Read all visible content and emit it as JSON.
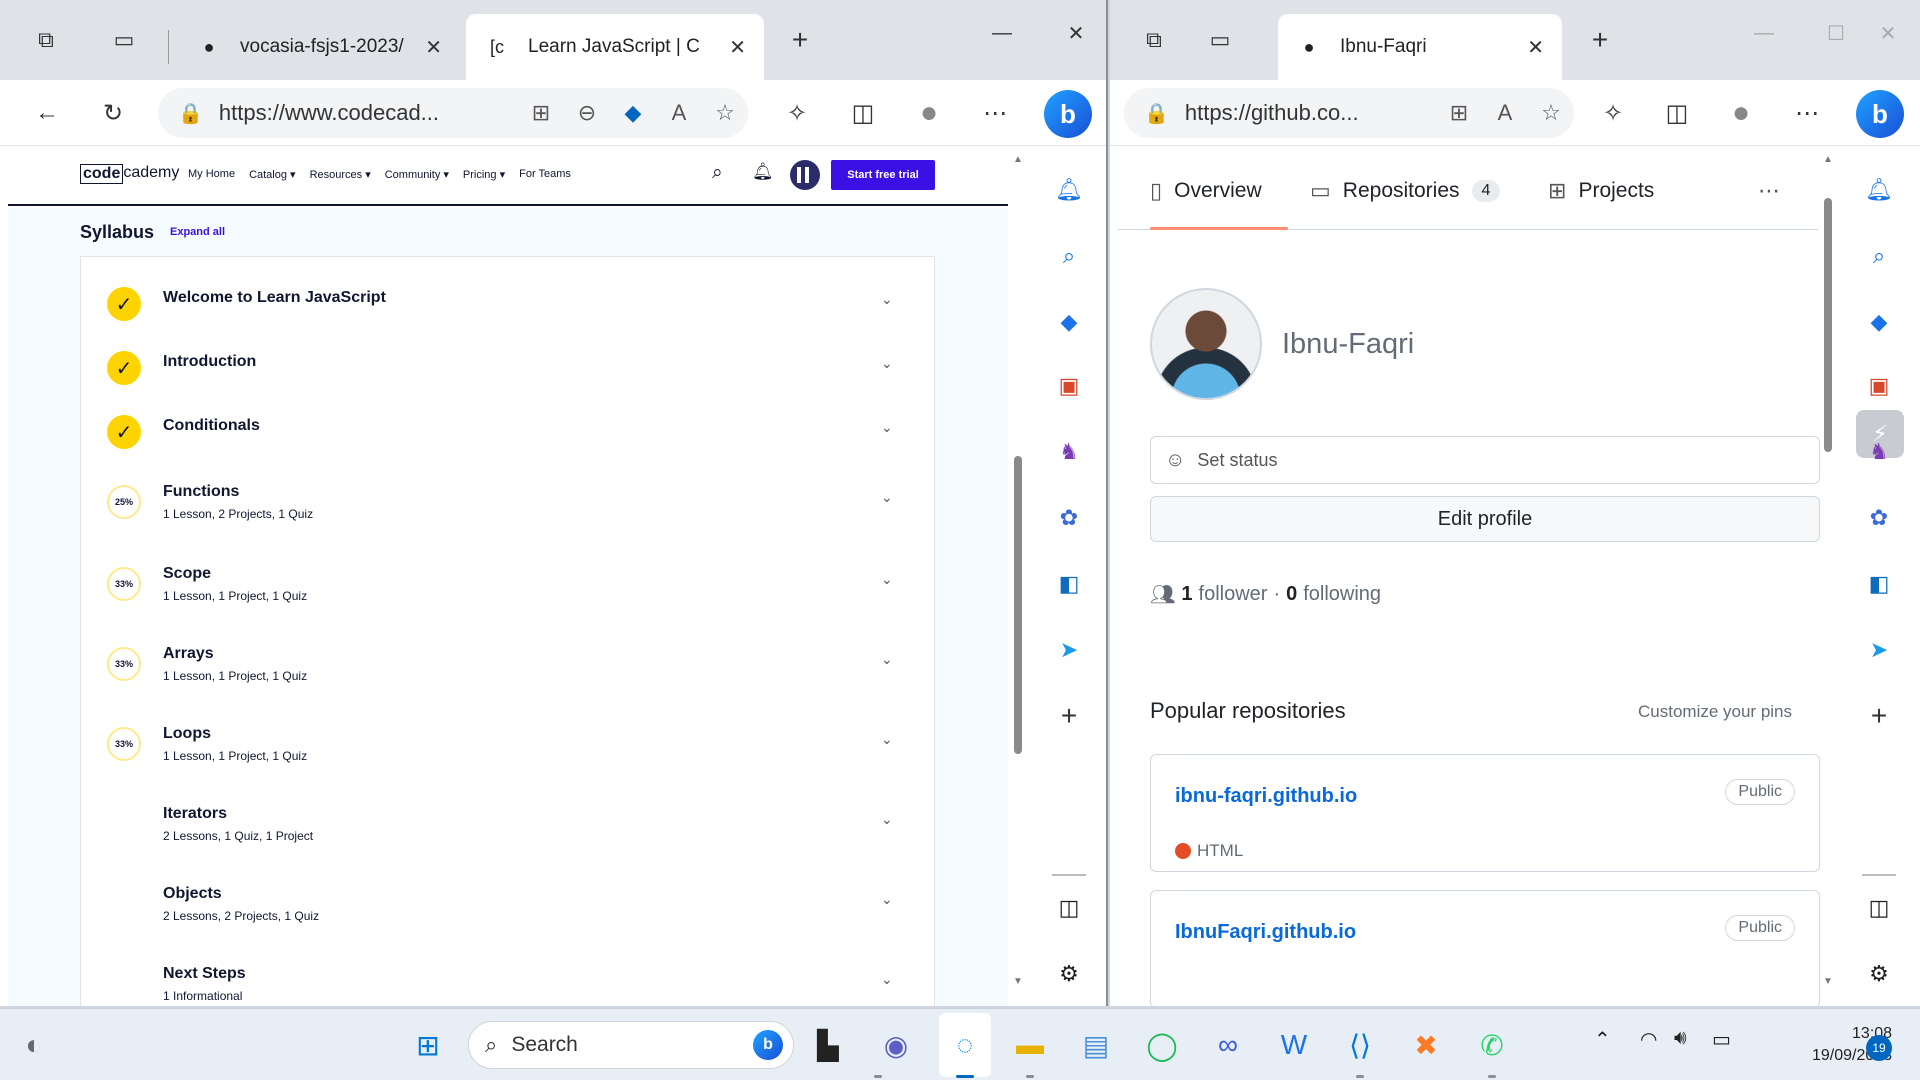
{
  "left_window": {
    "tabs": [
      {
        "title": "vocasia-fsjs1-2023/",
        "icon": "github-icon"
      },
      {
        "title": "Learn JavaScript | C",
        "icon": "codecademy-icon"
      }
    ],
    "url": "https://www.codecad...",
    "page": {
      "logo_box": "code",
      "logo_rest": "cademy",
      "nav": [
        "My Home",
        "Catalog ▾",
        "Resources ▾",
        "Community ▾",
        "Pricing ▾",
        "For Teams"
      ],
      "cta": "Start free trial",
      "syllabus_title": "Syllabus",
      "expand_all": "Expand all",
      "modules": [
        {
          "title": "Welcome to Learn JavaScript",
          "sub": "",
          "status": "done",
          "badge": "✓"
        },
        {
          "title": "Introduction",
          "sub": "",
          "status": "done",
          "badge": "✓"
        },
        {
          "title": "Conditionals",
          "sub": "",
          "status": "done",
          "badge": "✓"
        },
        {
          "title": "Functions",
          "sub": "1 Lesson, 2 Projects, 1 Quiz",
          "status": "progress",
          "badge": "25%"
        },
        {
          "title": "Scope",
          "sub": "1 Lesson, 1 Project, 1 Quiz",
          "status": "progress",
          "badge": "33%"
        },
        {
          "title": "Arrays",
          "sub": "1 Lesson, 1 Project, 1 Quiz",
          "status": "progress",
          "badge": "33%"
        },
        {
          "title": "Loops",
          "sub": "1 Lesson, 1 Project, 1 Quiz",
          "status": "progress",
          "badge": "33%"
        },
        {
          "title": "Iterators",
          "sub": "2 Lessons, 1 Quiz, 1 Project",
          "status": "none",
          "badge": ""
        },
        {
          "title": "Objects",
          "sub": "2 Lessons, 2 Projects, 1 Quiz",
          "status": "none",
          "badge": ""
        },
        {
          "title": "Next Steps",
          "sub": "1 Informational",
          "status": "none",
          "badge": ""
        }
      ]
    }
  },
  "right_window": {
    "tabs": [
      {
        "title": "Ibnu-Faqri",
        "icon": "github-icon"
      }
    ],
    "url": "https://github.co...",
    "page": {
      "tabs": [
        {
          "label": "Overview",
          "icon": "book-icon"
        },
        {
          "label": "Repositories",
          "icon": "repo-icon",
          "count": "4"
        },
        {
          "label": "Projects",
          "icon": "table-icon"
        }
      ],
      "username": "Ibnu-Faqri",
      "set_status": "Set status",
      "edit_profile": "Edit profile",
      "followers_count": "1",
      "followers_label": "follower",
      "separator": "·",
      "following_count": "0",
      "following_label": "following",
      "popular_title": "Popular repositories",
      "customize": "Customize your pins",
      "repos": [
        {
          "name": "ibnu-faqri.github.io",
          "visibility": "Public",
          "language": "HTML"
        },
        {
          "name": "IbnuFaqri.github.io",
          "visibility": "Public",
          "language": ""
        }
      ]
    }
  },
  "taskbar": {
    "search_placeholder": "Search",
    "time": "13:08",
    "date": "19/09/2023",
    "notifications": "19"
  },
  "colors": {
    "codecademy_purple": "#3a10e5",
    "codecademy_yellow": "#ffd300",
    "github_link": "#0969da",
    "html_lang": "#e34c26",
    "edge_active_blue": "#0067c0"
  }
}
